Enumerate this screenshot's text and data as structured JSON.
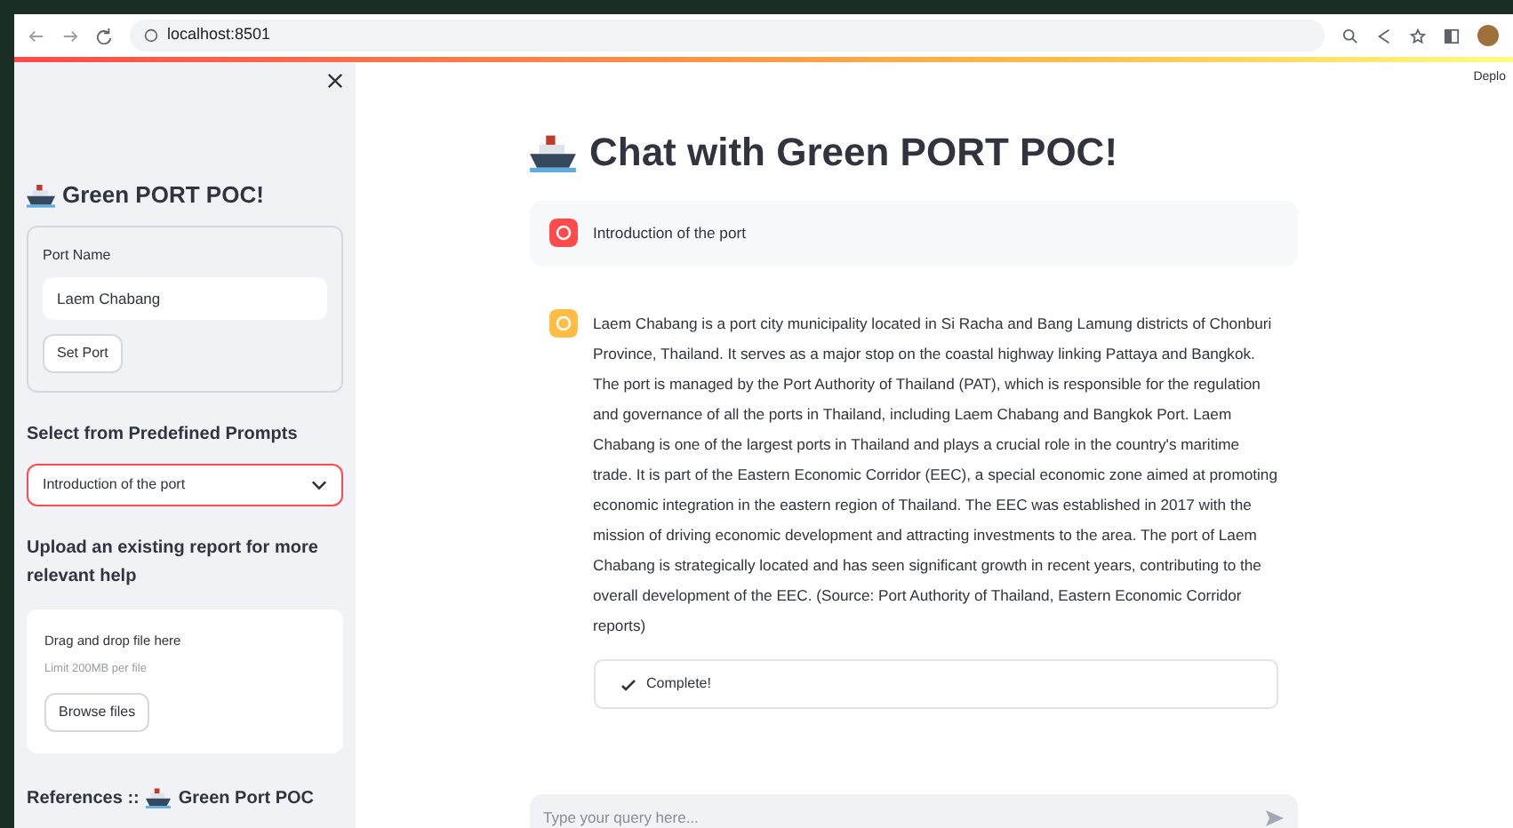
{
  "browser": {
    "url": "localhost:8501"
  },
  "header": {
    "deploy": "Deplo"
  },
  "sidebar": {
    "title": "Green PORT POC!",
    "port_form": {
      "label": "Port Name",
      "value": "Laem Chabang",
      "button": "Set Port"
    },
    "prompts": {
      "label": "Select from Predefined Prompts",
      "value": "Introduction of the port"
    },
    "upload": {
      "label": "Upload an existing report for more relevant help",
      "drop_text": "Drag and drop file here",
      "limit": "Limit 200MB per file",
      "button": "Browse files"
    },
    "references": {
      "label": "References ::",
      "name": "Green Port POC"
    }
  },
  "main": {
    "title": "Chat with Green PORT POC!",
    "messages": [
      {
        "kind": "user",
        "text": "Introduction of the port"
      },
      {
        "kind": "assistant",
        "text": "Laem Chabang is a port city municipality located in Si Racha and Bang Lamung districts of Chonburi Province, Thailand. It serves as a major stop on the coastal highway linking Pattaya and Bangkok. The port is managed by the Port Authority of Thailand (PAT), which is responsible for the regulation and governance of all the ports in Thailand, including Laem Chabang and Bangkok Port. Laem Chabang is one of the largest ports in Thailand and plays a crucial role in the country's maritime trade. It is part of the Eastern Economic Corridor (EEC), a special economic zone aimed at promoting economic integration in the eastern region of Thailand. The EEC was established in 2017 with the mission of driving economic development and attracting investments to the area. The port of Laem Chabang is strategically located and has seen significant growth in recent years, contributing to the overall development of the EEC. (Source: Port Authority of Thailand, Eastern Economic Corridor reports)",
        "status": "Complete!"
      }
    ],
    "input": {
      "placeholder": "Type your query here..."
    }
  }
}
